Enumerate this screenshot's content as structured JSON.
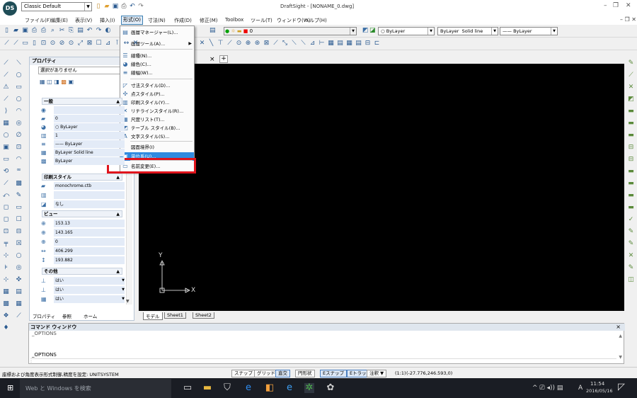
{
  "app": {
    "logo_text": "DS",
    "workspace": "Classic Default",
    "title": "DraftSight - [NONAME_0.dwg]"
  },
  "menubar": [
    "ファイル(F)",
    "編集(E)",
    "表示(V)",
    "挿入(I)",
    "形式(O)",
    "寸法(N)",
    "作成(D)",
    "修正(M)",
    "Toolbox",
    "ツール(T)",
    "ウィンドウ(W)",
    "ヘルプ(H)"
  ],
  "toolbar": {
    "layer_value": "0",
    "color_value": "ByLayer",
    "linestyle_value": "ByLayer",
    "linestyle_name": "Solid line",
    "lineweight_value": "—— ByLayer"
  },
  "dropdown": [
    {
      "icon": "layer-manager-icon",
      "glyph": "▤",
      "label": "画層マネージャー(L)..."
    },
    {
      "icon": "layer-tools-icon",
      "glyph": " ",
      "label": "画層ツール(A)...",
      "submenu": true
    },
    {
      "icon": "line-style-icon",
      "glyph": "☰",
      "label": "線種(N)..."
    },
    {
      "icon": "line-color-icon",
      "glyph": "◕",
      "label": "線色(C)..."
    },
    {
      "icon": "line-weight-icon",
      "glyph": "≡",
      "label": "線幅(W)..."
    },
    {
      "icon": "dim-style-icon",
      "glyph": "◸",
      "label": "寸法スタイル(D)..."
    },
    {
      "icon": "point-style-icon",
      "glyph": "✣",
      "label": "点スタイル(P)..."
    },
    {
      "icon": "print-style-icon",
      "glyph": "▥",
      "label": "印刷スタイル(Y)..."
    },
    {
      "icon": "leader-style-icon",
      "glyph": "✕",
      "label": "リチラインスタイル(R)..."
    },
    {
      "icon": "scale-list-icon",
      "glyph": "▦",
      "label": "尺度リスト(T)..."
    },
    {
      "icon": "table-style-icon",
      "glyph": "◩",
      "label": "テーブル スタイル(B)..."
    },
    {
      "icon": "text-style-icon",
      "glyph": "A",
      "label": "文字スタイル(S)..."
    },
    {
      "icon": "drawing-bounds-icon",
      "glyph": " ",
      "label": "図面境界(I)"
    },
    {
      "icon": "unit-system-icon",
      "glyph": "▣",
      "label": "単位系(U)...",
      "selected": true
    },
    {
      "icon": "rename-icon",
      "glyph": "▭",
      "label": "名前変更(E)..."
    }
  ],
  "props": {
    "title": "プロパティ",
    "selection": "選択がありません",
    "sections": {
      "general": "一般",
      "print_style": "印刷スタイル",
      "view": "ビュー",
      "other": "その他"
    },
    "general_rows": [
      "",
      "0",
      "○ ByLayer",
      "1",
      "—— ByLayer",
      "ByLayer   Solid line",
      "ByLayer"
    ],
    "print_rows": [
      "monochrome.ctb",
      "",
      "なし"
    ],
    "view_rows": [
      "153.13",
      "143.165",
      "0",
      "406.299",
      "193.882"
    ],
    "other_rows": [
      "はい",
      "はい",
      "はい"
    ],
    "tabs": [
      "プロパティ",
      "参照",
      "ホーム"
    ]
  },
  "canvas": {
    "tab_close": "×",
    "tab_add": "+",
    "axis_y": "Y",
    "axis_x": "X",
    "sheets": [
      "モデル",
      "Sheet1",
      "Sheet2"
    ]
  },
  "command": {
    "title": "コマンド ウィンドウ",
    "line1": "_OPTIONS",
    "line2": "_OPTIONS",
    "line3": ":",
    "close": "×"
  },
  "status": {
    "message": "座標および角度表示形式制御,精度を設定: UNITSYSTEM",
    "buttons": [
      {
        "label": "スナップ",
        "on": false
      },
      {
        "label": "グリッド",
        "on": false
      },
      {
        "label": "直交",
        "on": true
      },
      {
        "label": "円形状",
        "on": false
      },
      {
        "label": "Eスナップ",
        "on": true
      },
      {
        "label": "Eトラック",
        "on": true
      },
      {
        "label": "注釈 ▼",
        "on": false
      }
    ],
    "scale": "(1:1)",
    "coords": "(-27.776,246.593,0)"
  },
  "taskbar": {
    "search_placeholder": "Web と Windows を検索",
    "time": "11:54",
    "date": "2016/05/16",
    "ime": "A"
  }
}
